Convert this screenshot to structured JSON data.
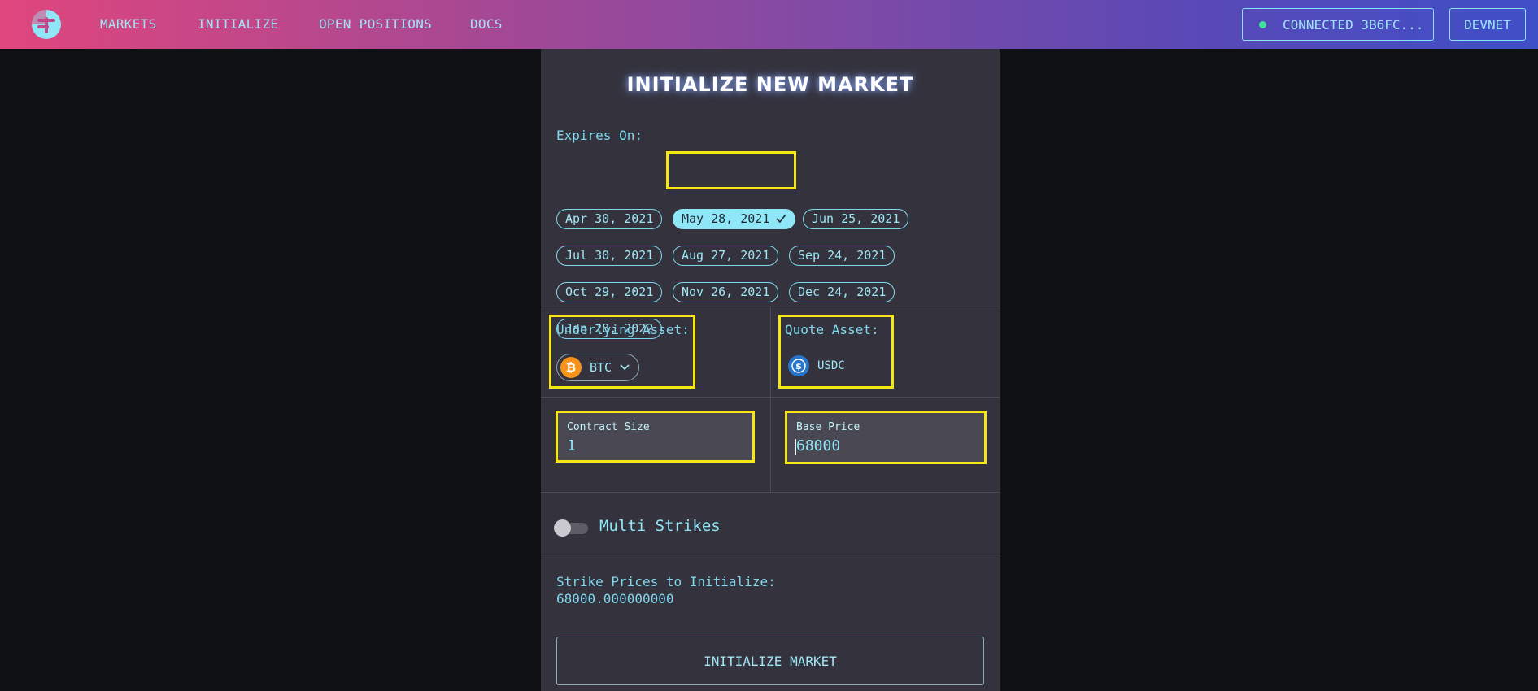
{
  "nav": {
    "links": [
      "MARKETS",
      "INITIALIZE",
      "OPEN POSITIONS",
      "DOCS"
    ],
    "connected_label": "CONNECTED 3B6FC...",
    "network_label": "DEVNET"
  },
  "form": {
    "title": "INITIALIZE NEW MARKET",
    "expires_label": "Expires On:",
    "expiry_dates": [
      "Apr 30, 2021",
      "May 28, 2021",
      "Jun 25, 2021",
      "Jul 30, 2021",
      "Aug 27, 2021",
      "Sep 24, 2021",
      "Oct 29, 2021",
      "Nov 26, 2021",
      "Dec 24, 2021",
      "Jan 28, 2022"
    ],
    "selected_expiry": "May 28, 2021",
    "underlying_label": "Underlying Asset:",
    "underlying_value": "BTC",
    "quote_label": "Quote Asset:",
    "quote_value": "USDC",
    "contract_size_label": "Contract Size",
    "contract_size_value": "1",
    "base_price_label": "Base Price",
    "base_price_value": "68000",
    "multi_strikes_label": "Multi Strikes",
    "multi_strikes_enabled": false,
    "strike_prices_label": "Strike Prices to Initialize:",
    "strike_prices_value": "68000.000000000",
    "submit_label": "INITIALIZE MARKET"
  },
  "colors": {
    "accent": "#8fe6f6",
    "highlight": "#f4e712",
    "card": "#34333d",
    "background": "#0f1014"
  }
}
